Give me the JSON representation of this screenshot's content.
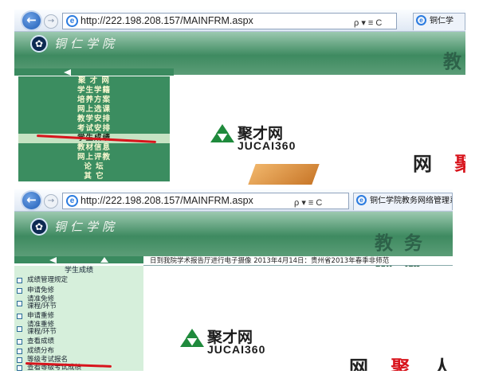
{
  "screenshot_top": {
    "browser": {
      "url": "http://222.198.208.157/MAINFRM.aspx",
      "addr_controls": "ρ ▾ ≡ C",
      "tab_label": "铜仁学"
    },
    "banner": {
      "school_name": "铜仁学院",
      "title_partial": "教"
    },
    "menu": {
      "items": [
        "聚 才 网",
        "学生学籍",
        "培养方案",
        "网上选课",
        "教学安排",
        "考试安排",
        "学生成绩",
        "教材信息",
        "网上评教",
        "论    坛",
        "其    它"
      ],
      "selected_index": 6
    },
    "content": {
      "brand_cn": "聚才网",
      "brand_en": "JUCAI360",
      "slogan_partial": "网 聚"
    }
  },
  "screenshot_bottom": {
    "browser": {
      "url": "http://222.198.208.157/MAINFRM.aspx",
      "addr_controls": "ρ ▾ ≡ C",
      "tab_label": "铜仁学院教务网络管理系"
    },
    "banner": {
      "school_name": "铜仁学院",
      "title_partial": "教 务 网 络"
    },
    "marquee": "日到我院学术报告厅进行电子摄像    2013年4月14日：贵州省2013年春季非师范",
    "menu": {
      "category": "学生成绩",
      "items": [
        {
          "line1": "成绩管理规定",
          "line2": ""
        },
        {
          "line1": "申请免修",
          "line2": ""
        },
        {
          "line1": "请准免修",
          "line2": "课程/环节"
        },
        {
          "line1": "申请重修",
          "line2": ""
        },
        {
          "line1": "请准重修",
          "line2": "课程/环节"
        },
        {
          "line1": "查看成绩",
          "line2": ""
        },
        {
          "line1": "成绩分布",
          "line2": ""
        },
        {
          "line1": "等级考试报名",
          "line2": ""
        },
        {
          "line1": "查看等级考试成绩",
          "line2": ""
        }
      ],
      "highlighted_index": 7
    },
    "content": {
      "brand_cn": "聚才网",
      "brand_en": "JUCAI360",
      "slogan_partial": "网 聚 人 才"
    }
  },
  "colors": {
    "nav_green": "#3b8d60",
    "nav_text": "#f7f7cf",
    "menu_bg_light": "#d6efdb",
    "annotation_red": "#d8141c",
    "brand_orange": "#e28a2b"
  }
}
